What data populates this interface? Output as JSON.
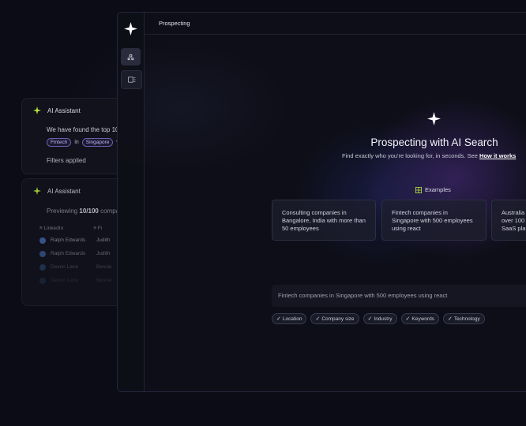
{
  "assistant_card_1": {
    "title": "AI Assistant",
    "message": "We have found the top 10",
    "chip_industry": "Fintech",
    "chip_connector": "in",
    "chip_location": "Singapore",
    "chip_tail": "w",
    "filters_applied": "Filters applied"
  },
  "assistant_card_2": {
    "title": "AI Assistant",
    "preview_prefix": "Previewing",
    "preview_count": "10/100",
    "preview_suffix": "compa",
    "table": {
      "col1": "LinkedIn",
      "col2": "Fi",
      "rows": [
        {
          "name": "Ralph Edwards",
          "second": "Judith"
        },
        {
          "name": "Ralph Edwards",
          "second": "Judith"
        },
        {
          "name": "Devon Lane",
          "second": "Bessie"
        },
        {
          "name": "Devon Lane",
          "second": "Bessie"
        }
      ]
    }
  },
  "app": {
    "page_title": "Prospecting",
    "hero_title": "Prospecting with AI Search",
    "hero_subtitle": "Find exactly who you're looking for, in seconds. See",
    "hero_link": "How it works",
    "examples_label": "Examples",
    "examples": [
      "Consulting companies in Bangalore, India with more than 50 employees",
      "Fintech companies in Singapore with 500 employees using react",
      "Australia over 100 SaaS pla"
    ],
    "search_value": "Fintech companies in Singapore with 500 employees using react",
    "filters": [
      "Location",
      "Company size",
      "Industry",
      "Keywords",
      "Technology"
    ]
  },
  "colors": {
    "background": "#0b0c15",
    "accent_purple": "#7b4fd6",
    "spark_green": "#b6e33c"
  }
}
